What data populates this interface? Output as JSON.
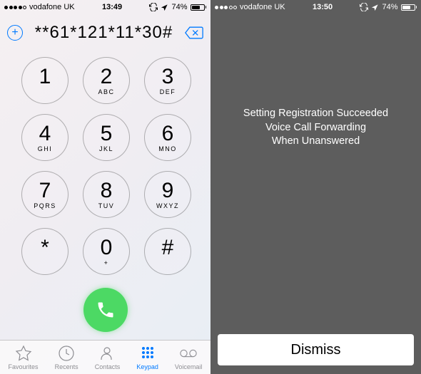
{
  "left": {
    "status": {
      "carrier": "vodafone UK",
      "time": "13:49",
      "battery_pct": "74%",
      "battery_fill": 74
    },
    "dialed_number": "**61*121*11*30#",
    "keys": [
      {
        "d": "1",
        "l": ""
      },
      {
        "d": "2",
        "l": "ABC"
      },
      {
        "d": "3",
        "l": "DEF"
      },
      {
        "d": "4",
        "l": "GHI"
      },
      {
        "d": "5",
        "l": "JKL"
      },
      {
        "d": "6",
        "l": "MNO"
      },
      {
        "d": "7",
        "l": "PQRS"
      },
      {
        "d": "8",
        "l": "TUV"
      },
      {
        "d": "9",
        "l": "WXYZ"
      },
      {
        "d": "*",
        "l": ""
      },
      {
        "d": "0",
        "l": "+"
      },
      {
        "d": "#",
        "l": ""
      }
    ],
    "tabs": [
      {
        "id": "favourites",
        "label": "Favourites",
        "active": false
      },
      {
        "id": "recents",
        "label": "Recents",
        "active": false
      },
      {
        "id": "contacts",
        "label": "Contacts",
        "active": false
      },
      {
        "id": "keypad",
        "label": "Keypad",
        "active": true
      },
      {
        "id": "voicemail",
        "label": "Voicemail",
        "active": false
      }
    ]
  },
  "right": {
    "status": {
      "carrier": "vodafone UK",
      "time": "13:50",
      "battery_pct": "74%",
      "battery_fill": 74
    },
    "message_line1": "Setting Registration Succeeded",
    "message_line2": "Voice Call Forwarding",
    "message_line3": "When Unanswered",
    "dismiss_label": "Dismiss"
  }
}
